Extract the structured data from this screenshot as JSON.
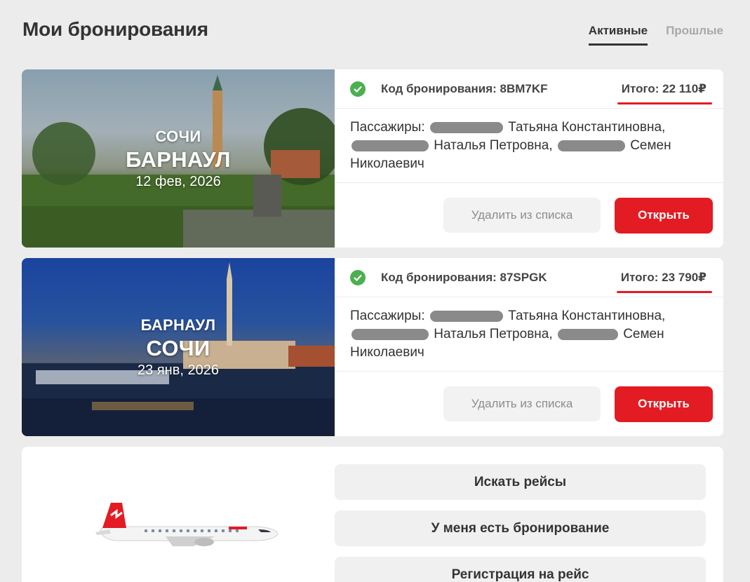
{
  "header": {
    "title": "Мои бронирования",
    "tabs": [
      {
        "label": "Активные",
        "active": true
      },
      {
        "label": "Прошлые",
        "active": false
      }
    ]
  },
  "bookings": [
    {
      "from": "СОЧИ",
      "to": "БАРНАУЛ",
      "date": "12 фев, 2026",
      "code_label": "Код бронирования: 8BM7KF",
      "total_label": "Итого: 22 110₽",
      "passengers_prefix": "Пассажиры:",
      "passenger_1": "Татьяна Константиновна,",
      "passenger_2": "Наталья Петровна,",
      "passenger_3": "Семен",
      "passenger_3b": "Николаевич",
      "delete_label": "Удалить из списка",
      "open_label": "Открыть"
    },
    {
      "from": "БАРНАУЛ",
      "to": "СОЧИ",
      "date": "23 янв, 2026",
      "code_label": "Код бронирования: 87SPGK",
      "total_label": "Итого: 23 790₽",
      "passengers_prefix": "Пассажиры:",
      "passenger_1": "Татьяна Константиновна,",
      "passenger_2": "Наталья Петровна,",
      "passenger_3": "Семен",
      "passenger_3b": "Николаевич",
      "delete_label": "Удалить из списка",
      "open_label": "Открыть"
    }
  ],
  "actions": {
    "search_flights": "Искать рейсы",
    "have_booking": "У меня есть бронирование",
    "checkin": "Регистрация на рейс"
  },
  "colors": {
    "accent": "#e31b23",
    "success": "#4caf50",
    "background": "#ececec"
  },
  "icons": {
    "status": "check-circle-icon"
  }
}
